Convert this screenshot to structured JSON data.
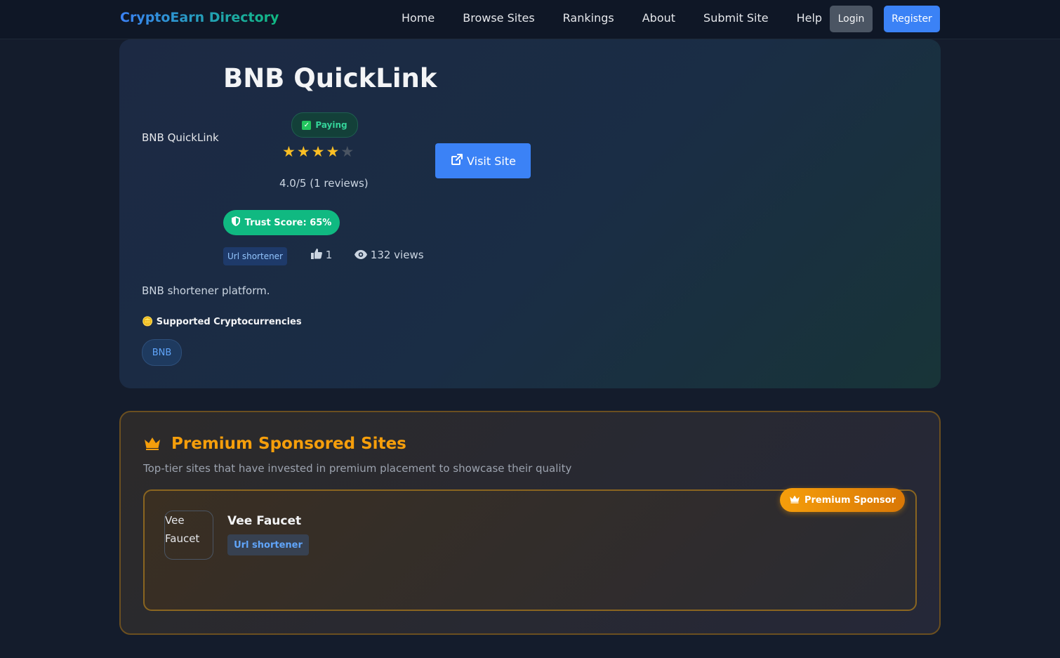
{
  "nav": {
    "brand": "CryptoEarn Directory",
    "links": [
      "Home",
      "Browse Sites",
      "Rankings",
      "About",
      "Submit Site",
      "Help"
    ],
    "login_label": "Login",
    "register_label": "Register"
  },
  "site": {
    "logo_alt": "BNB QuickLink",
    "title": "BNB QuickLink",
    "status": "Paying",
    "rating": 4,
    "rating_max": 5,
    "rating_text": "4.0/5 (1 reviews)",
    "visit_label": "Visit Site",
    "trust_score": "Trust Score: 65%",
    "category": "Url shortener",
    "likes": "1",
    "views": "132 views",
    "description": "BNB shortener platform.",
    "crypto_heading": "Supported Cryptocurrencies",
    "cryptos": [
      "BNB"
    ]
  },
  "premium": {
    "title": "Premium Sponsored Sites",
    "subtitle": "Top-tier sites that have invested in premium placement to showcase their quality",
    "sponsors": [
      {
        "badge": "Premium Sponsor",
        "logo_alt": "Vee Faucet",
        "name": "Vee Faucet",
        "category": "Url shortener"
      }
    ]
  },
  "colors": {
    "accent": "#3b82f6",
    "trust": "#10b981",
    "premium": "#f59e0b",
    "star": "#fbbf24"
  }
}
